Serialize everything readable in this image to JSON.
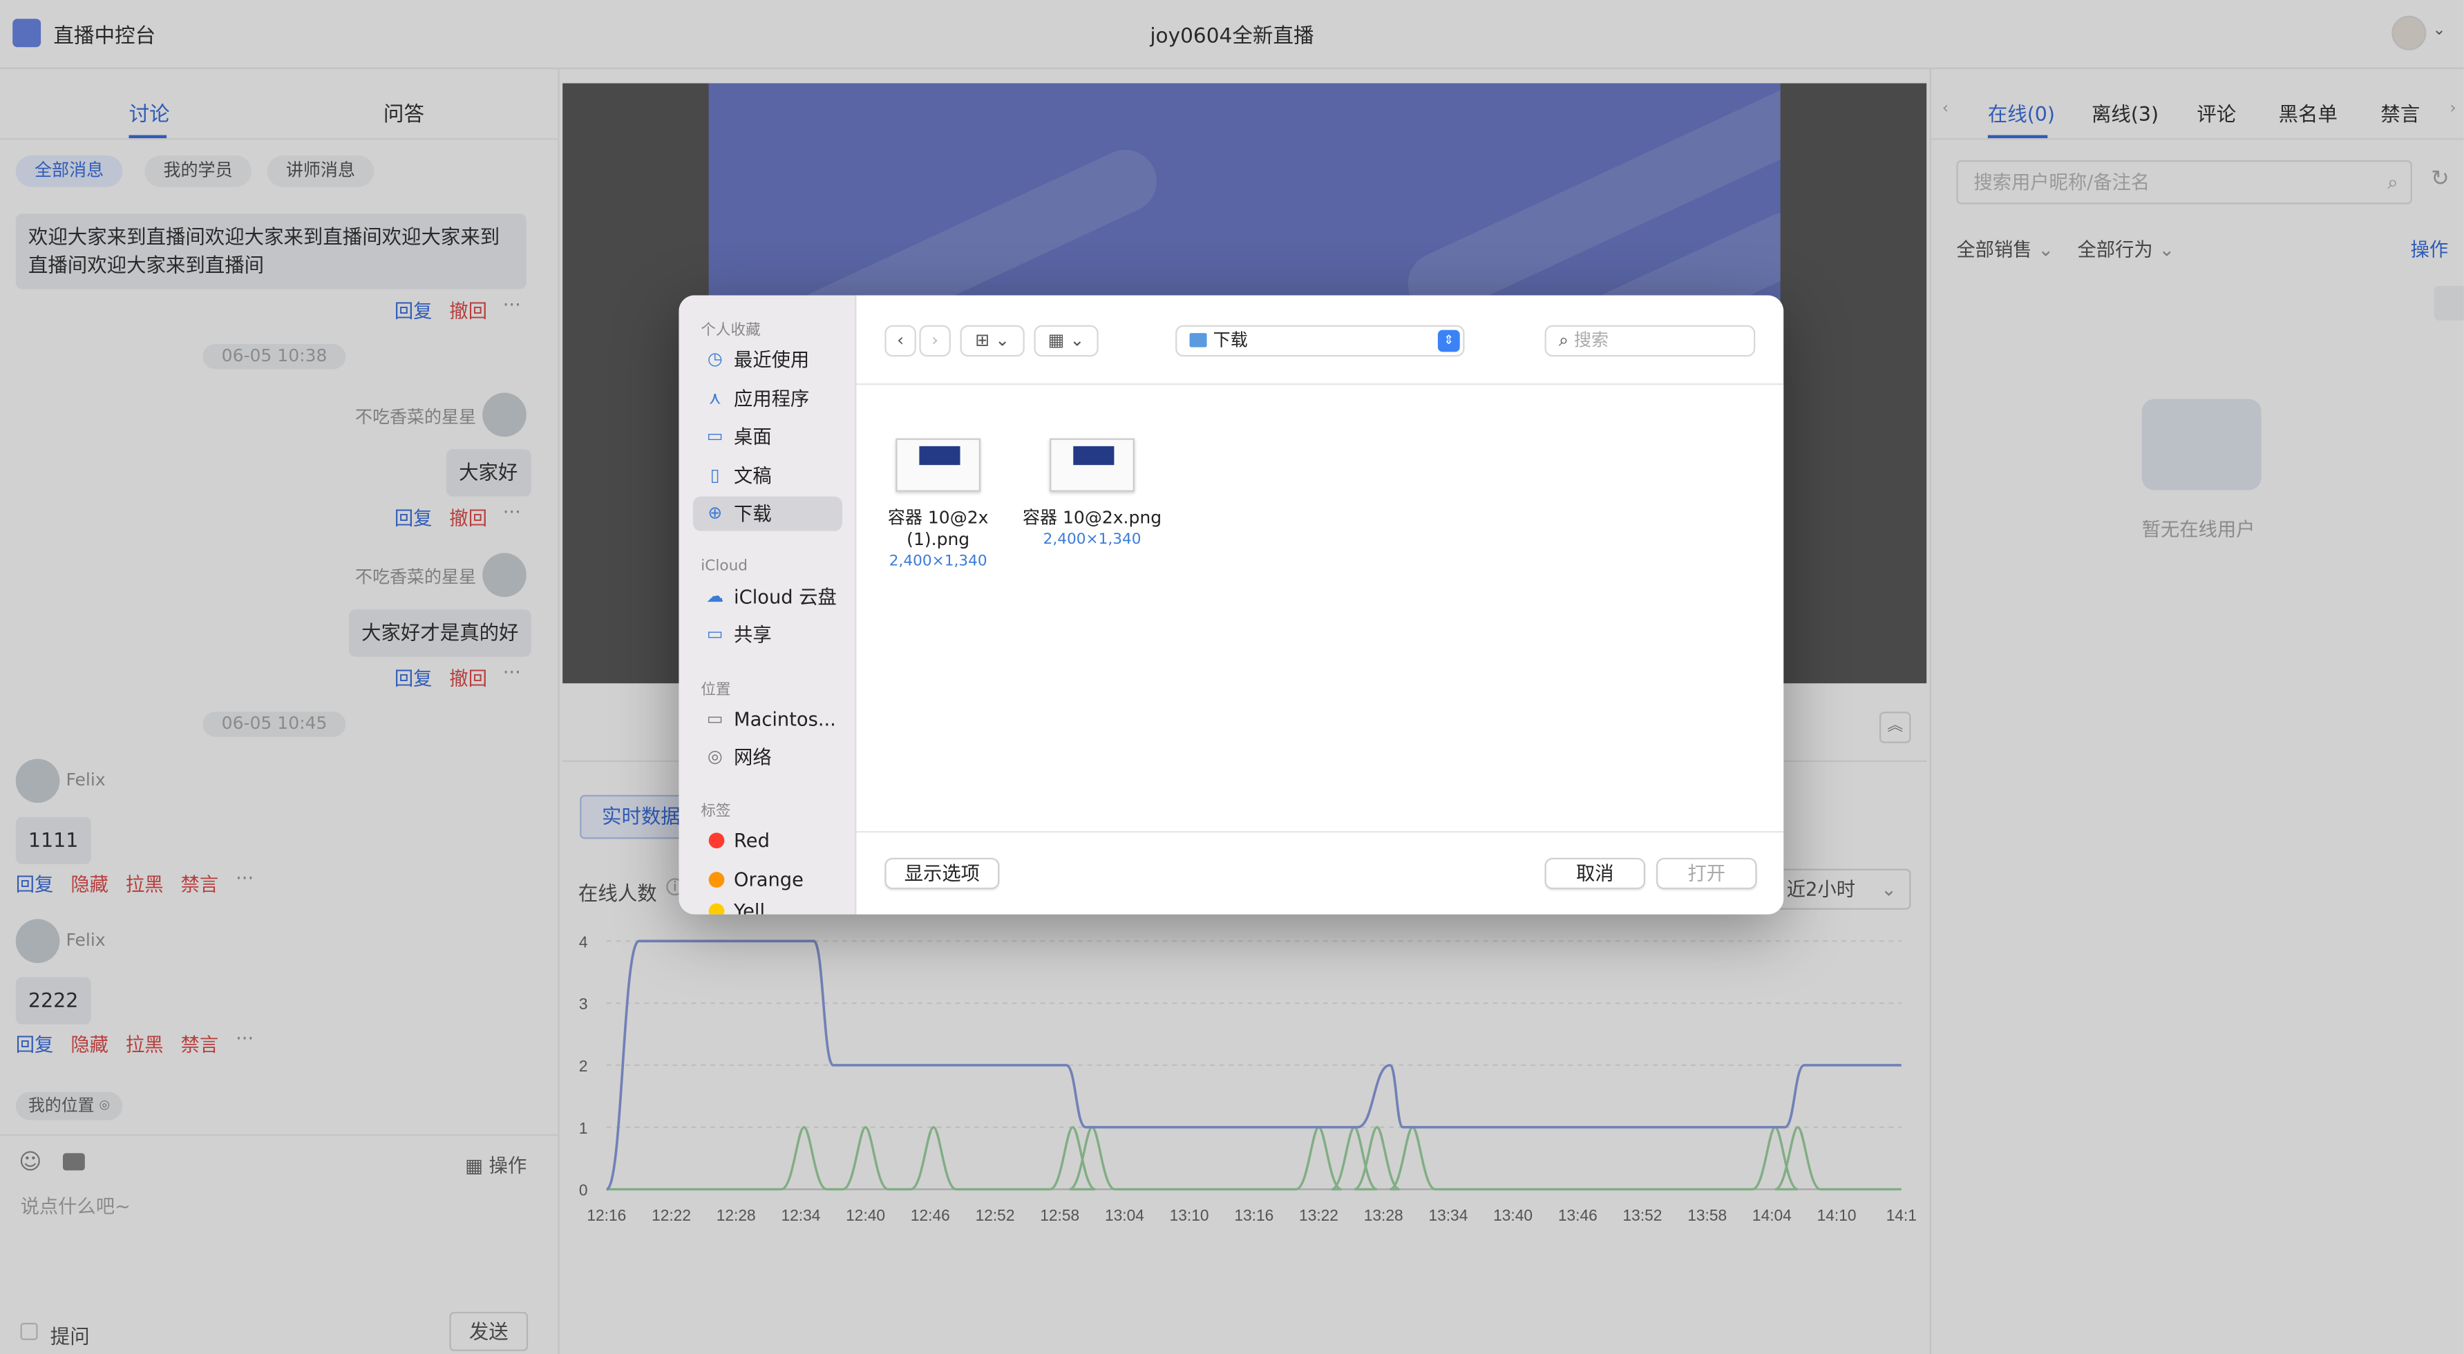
{
  "header": {
    "app_title": "直播中控台",
    "live_title": "joy0604全新直播"
  },
  "left": {
    "tabs": [
      "讨论",
      "问答"
    ],
    "filters": [
      "全部消息",
      "我的学员",
      "讲师消息"
    ],
    "messages": {
      "welcome": "欢迎大家来到直播间欢迎大家来到直播间欢迎大家来到直播间欢迎大家来到直播间",
      "reply": "回复",
      "recall": "撤回",
      "more": "···",
      "ts1": "06-05 10:38",
      "sender1": "不吃香菜的星星",
      "msg1": "大家好",
      "sender2": "不吃香菜的星星",
      "msg2": "大家好才是真的好",
      "ts2": "06-05 10:45",
      "felix1": "Felix",
      "felix1_msg": "1111",
      "felix2": "Felix",
      "felix2_msg": "2222",
      "hide": "隐藏",
      "block": "拉黑",
      "mute": "禁言"
    },
    "location": "我的位置",
    "ops": "操作",
    "input_placeholder": "说点什么吧~",
    "question": "提问",
    "send": "发送"
  },
  "center": {
    "realtime": "实时数据",
    "online_label": "在线人数",
    "range": "近2小时"
  },
  "chart_data": {
    "type": "line",
    "title": "",
    "xlabel": "",
    "ylabel": "在线人数",
    "ylim": [
      0,
      4
    ],
    "yticks": [
      0,
      1,
      2,
      3,
      4
    ],
    "x": [
      "12:16",
      "12:22",
      "12:28",
      "12:34",
      "12:40",
      "12:46",
      "12:52",
      "12:58",
      "13:04",
      "13:10",
      "13:16",
      "13:22",
      "13:28",
      "13:34",
      "13:40",
      "13:46",
      "13:52",
      "13:58",
      "14:04",
      "14:10",
      "14:1"
    ],
    "series": [
      {
        "name": "",
        "color": "#8a9ee0",
        "points": [
          [
            0,
            0
          ],
          [
            0.5,
            4
          ],
          [
            3.2,
            4
          ],
          [
            3.5,
            2
          ],
          [
            7.1,
            2
          ],
          [
            7.4,
            1
          ],
          [
            11.3,
            1
          ],
          [
            11.6,
            1
          ],
          [
            12.1,
            2
          ],
          [
            12.3,
            1
          ],
          [
            18.2,
            1
          ],
          [
            18.5,
            2
          ],
          [
            20,
            2
          ]
        ]
      },
      {
        "name": "",
        "color": "#9ed3a2",
        "peaks": [
          3.05,
          4.0,
          5.05,
          7.2,
          7.5,
          11.0,
          11.55,
          11.9,
          12.45,
          18.05,
          18.4
        ]
      }
    ]
  },
  "right": {
    "tabs": [
      "在线(0)",
      "离线(3)",
      "评论",
      "黑名单",
      "禁言"
    ],
    "search_placeholder": "搜索用户昵称/备注名",
    "filter_sales": "全部销售",
    "filter_behavior": "全部行为",
    "ops": "操作",
    "empty": "暂无在线用户"
  },
  "dialog": {
    "sections": {
      "favorites": "个人收藏",
      "icloud": "iCloud",
      "locations": "位置",
      "tags": "标签"
    },
    "favorites": [
      "最近使用",
      "应用程序",
      "桌面",
      "文稿",
      "下载"
    ],
    "icloud": [
      "iCloud 云盘",
      "共享"
    ],
    "locations": [
      "Macintos...",
      "网络"
    ],
    "tags": [
      {
        "label": "Red",
        "color": "#ff3b30"
      },
      {
        "label": "Orange",
        "color": "#ff9500"
      },
      {
        "label": "Yell",
        "color": "#ffcc00"
      }
    ],
    "folder": "下载",
    "search_placeholder": "搜索",
    "files": [
      {
        "name": "容器 10@2x (1).png",
        "dims": "2,400×1,340"
      },
      {
        "name": "容器 10@2x.png",
        "dims": "2,400×1,340"
      }
    ],
    "show_options": "显示选项",
    "cancel": "取消",
    "open": "打开"
  }
}
